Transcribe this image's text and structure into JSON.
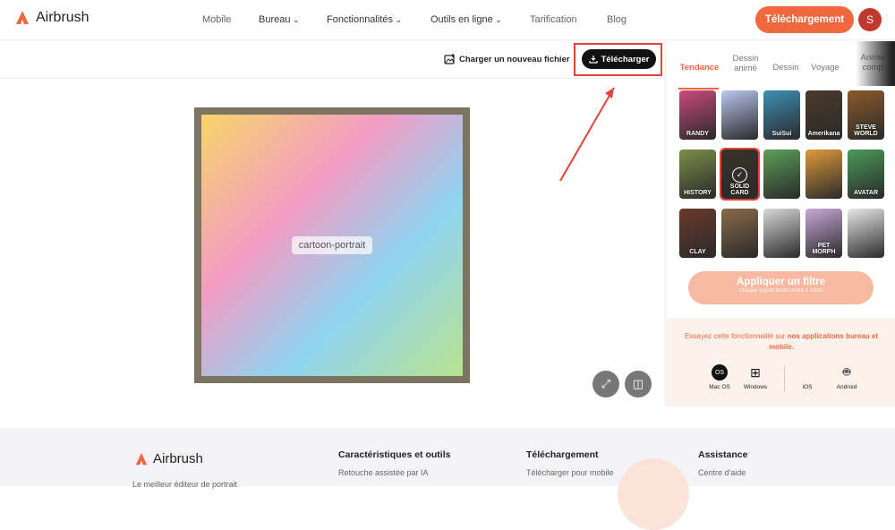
{
  "header": {
    "brand": "Airbrush",
    "nav": [
      {
        "label": "Mobile",
        "chevron": false
      },
      {
        "label": "Bureau",
        "chevron": true
      },
      {
        "label": "Fonctionnalités",
        "chevron": true
      },
      {
        "label": "Outils en ligne",
        "chevron": true
      },
      {
        "label": "Tarification",
        "chevron": false
      },
      {
        "label": "Blog",
        "chevron": false
      }
    ],
    "download_label": "Téléchargement",
    "avatar_initial": "S",
    "accent_color": "#f0693e"
  },
  "toolbar": {
    "upload_new_label": "Charger un nouveau fichier",
    "download_label": "Télécharger"
  },
  "panel": {
    "tabs": [
      {
        "label": "Tendance",
        "active": true
      },
      {
        "label": "Dessin animé",
        "active": false
      },
      {
        "label": "Dessin",
        "active": false
      },
      {
        "label": "Voyage",
        "active": false
      },
      {
        "label": "Anime comp",
        "active": false
      }
    ],
    "thumbnails": [
      {
        "label": "RANDY",
        "color": "#c94a7a"
      },
      {
        "label": "",
        "color": "#b9c7f0"
      },
      {
        "label": "SuiSui",
        "color": "#3d8fb5"
      },
      {
        "label": "Amerikana",
        "color": "#4a3a2a"
      },
      {
        "label": "STEVE WORLD",
        "color": "#8a5a2a"
      },
      {
        "label": "HISTORY",
        "color": "#7a8f4a"
      },
      {
        "label": "SOLID CARD",
        "color": "#3a3228"
      },
      {
        "label": "",
        "color": "#5aa05a"
      },
      {
        "label": "",
        "color": "#e09a3a"
      },
      {
        "label": "AVATAR",
        "color": "#4a9a5a"
      },
      {
        "label": "CLAY",
        "color": "#6a3a2a"
      },
      {
        "label": "",
        "color": "#8a6a4a"
      },
      {
        "label": "",
        "color": "#d8d8d8"
      },
      {
        "label": "PET MORPH",
        "color": "#c8a8d8"
      },
      {
        "label": "",
        "color": "#e8e8e8"
      }
    ],
    "selected_index": 6,
    "apply_label": "Appliquer un filtre",
    "apply_sub": "Chaque export photo coûte 1 crédit",
    "promo_text": "Essayez cette fonctionnalité sur",
    "promo_bold": "nos applications bureau et mobile.",
    "platforms": [
      "Mac OS",
      "Windows",
      "iOS",
      "Android"
    ]
  },
  "footer": {
    "brand": "Airbrush",
    "tagline": "Le meilleur éditeur de portrait",
    "columns": [
      {
        "heading": "Caractéristiques et outils",
        "first": "Retouche assistée par IA"
      },
      {
        "heading": "Téléchargement",
        "first": "Télécharger pour mobile"
      },
      {
        "heading": "Assistance",
        "first": "Centre d'aide"
      }
    ]
  },
  "canvas": {
    "image_name": "cartoon-portrait"
  }
}
